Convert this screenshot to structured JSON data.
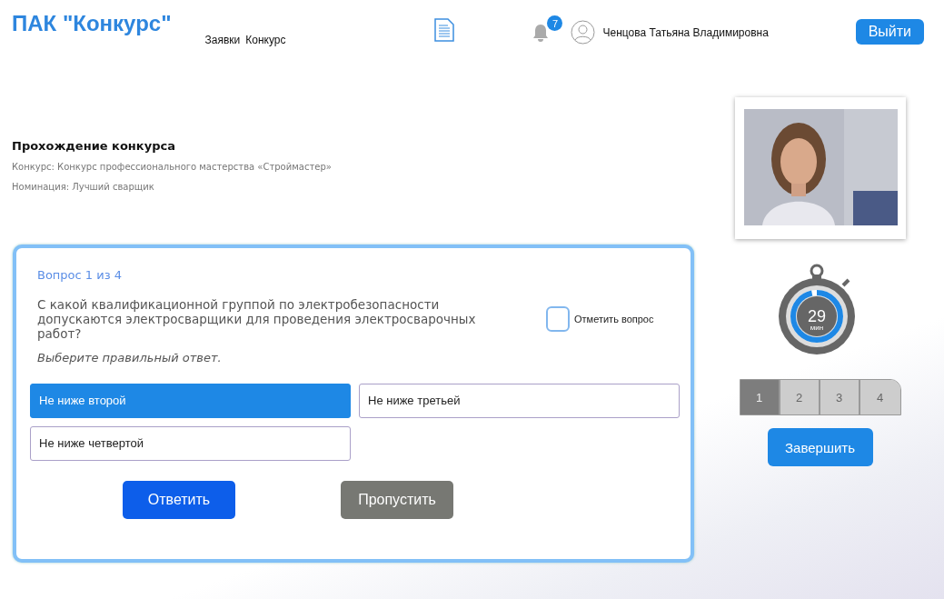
{
  "header": {
    "logo": "ПАК \"Конкурс\"",
    "nav": [
      {
        "label": "Заявки"
      },
      {
        "label": "Конкурс"
      }
    ],
    "notifications": {
      "count": "7"
    },
    "user": "Ченцова Татьяна Владимировна",
    "logout": "Выйти"
  },
  "contest": {
    "title": "Прохождение конкурса",
    "lines": [
      "Конкурс: Конкурс профессионального мастерства «Строймастер»",
      "Номинация: Лучший сварщик"
    ]
  },
  "question": {
    "counter": "Вопрос 1 из 4",
    "text": "С какой квалификационной группой по электробезопасности допускаются электросварщики для проведения электросварочных работ?",
    "hint": "Выберите правильный ответ.",
    "flag": {
      "label": "Отметить вопрос",
      "checked": false
    },
    "answers": [
      {
        "label": "Не ниже второй",
        "selected": true
      },
      {
        "label": "Не ниже третьей",
        "selected": false
      },
      {
        "label": "Не ниже четвертой",
        "selected": false
      }
    ],
    "buttons": [
      {
        "label": "Ответить",
        "kind": "primary"
      },
      {
        "label": "Пропустить",
        "kind": "secondary"
      }
    ]
  },
  "timer": {
    "value": "29",
    "unit": "мин",
    "level": 0.96
  },
  "pages": [
    {
      "label": "1",
      "selected": true
    },
    {
      "label": "2",
      "selected": false
    },
    {
      "label": "3",
      "selected": false
    },
    {
      "label": "4",
      "selected": false
    }
  ],
  "finish": "Завершить"
}
